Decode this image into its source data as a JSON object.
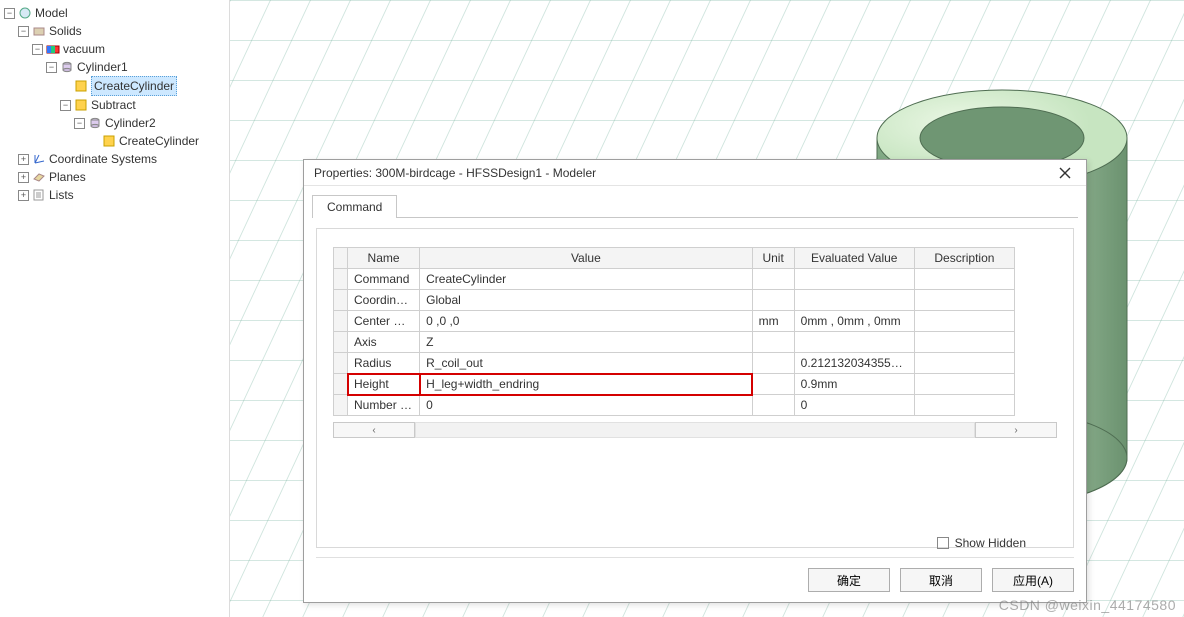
{
  "tree": {
    "model": "Model",
    "solids": "Solids",
    "vacuum": "vacuum",
    "cyl1": "Cylinder1",
    "createCyl1": "CreateCylinder",
    "subtract": "Subtract",
    "cyl2": "Cylinder2",
    "createCyl2": "CreateCylinder",
    "coordSys": "Coordinate Systems",
    "planes": "Planes",
    "lists": "Lists"
  },
  "dialog": {
    "title": "Properties: 300M-birdcage - HFSSDesign1 - Modeler",
    "tab": "Command",
    "columns": {
      "name": "Name",
      "value": "Value",
      "unit": "Unit",
      "eval": "Evaluated Value",
      "desc": "Description"
    },
    "rows": [
      {
        "name": "Command",
        "value": "CreateCylinder",
        "unit": "",
        "eval": ""
      },
      {
        "name": "Coordinate ...",
        "value": "Global",
        "unit": "",
        "eval": ""
      },
      {
        "name": "Center Positi...",
        "value": "0 ,0 ,0",
        "unit": "mm",
        "eval": "0mm , 0mm , 0mm"
      },
      {
        "name": "Axis",
        "value": "Z",
        "unit": "",
        "eval": ""
      },
      {
        "name": "Radius",
        "value": "R_coil_out",
        "unit": "",
        "eval": "0.21213203435596..."
      },
      {
        "name": "Height",
        "value": "H_leg+width_endring",
        "unit": "",
        "eval": "0.9mm",
        "hl": true
      },
      {
        "name": "Number of ...",
        "value": "0",
        "unit": "",
        "eval": "0"
      }
    ],
    "showHidden": "Show Hidden",
    "buttons": {
      "ok": "确定",
      "cancel": "取消",
      "apply": "应用(A)"
    }
  },
  "watermark": "CSDN @weixin_44174580"
}
